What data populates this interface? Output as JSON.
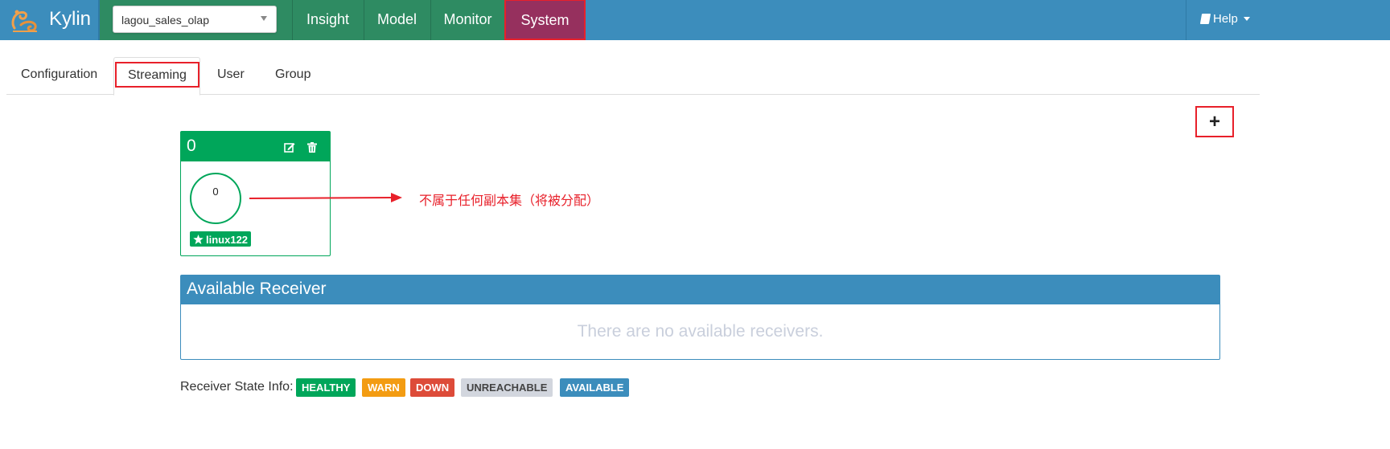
{
  "navbar": {
    "brand": "Kylin",
    "project_select": {
      "value": "lagou_sales_olap"
    },
    "items": [
      "Insight",
      "Model",
      "Monitor",
      "System"
    ],
    "help_label": "Help"
  },
  "tabs": {
    "items": [
      "Configuration",
      "Streaming",
      "User",
      "Group"
    ],
    "active": "Streaming"
  },
  "add_button": {
    "label": "+"
  },
  "replica_set": {
    "id": "0",
    "node_id": "0",
    "leader_host": "linux122"
  },
  "annotation": {
    "text": "不属于任何副本集（将被分配）"
  },
  "available_receiver": {
    "title": "Available Receiver",
    "empty_message": "There are no available receivers."
  },
  "receiver_state": {
    "label": "Receiver State Info:",
    "states": [
      "HEALTHY",
      "WARN",
      "DOWN",
      "UNREACHABLE",
      "AVAILABLE"
    ]
  },
  "colors": {
    "navbar": "#3c8dbc",
    "nav_green": "#2e8b62",
    "system_active": "#96305e",
    "healthy": "#00a65a",
    "warn": "#f39c12",
    "down": "#dd4b39",
    "unreachable": "#d2d6de",
    "available": "#3c8dbc",
    "highlight": "#e8202a"
  }
}
